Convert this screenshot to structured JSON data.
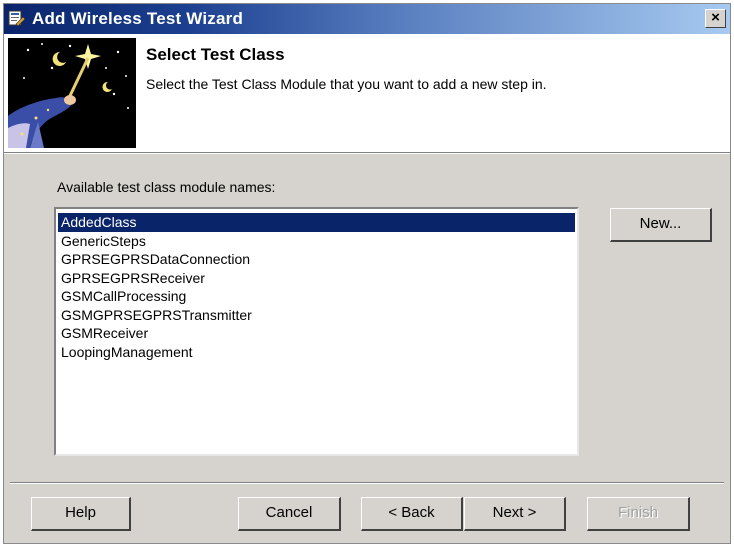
{
  "window": {
    "title": "Add Wireless Test Wizard",
    "close_label": "×"
  },
  "header": {
    "title": "Select Test Class",
    "description": "Select the Test Class Module that you want to add a new step in."
  },
  "list": {
    "label": "Available test class module names:",
    "selected_index": 0,
    "items": [
      "AddedClass",
      "GenericSteps",
      "GPRSEGPRSDataConnection",
      "GPRSEGPRSReceiver",
      "GSMCallProcessing",
      "GSMGPRSEGPRSTransmitter",
      "GSMReceiver",
      "LoopingManagement"
    ]
  },
  "buttons": {
    "new": "New...",
    "help": "Help",
    "cancel": "Cancel",
    "back": "< Back",
    "next": "Next >",
    "finish": "Finish"
  },
  "icons": {
    "app": "wizard-app-icon",
    "close": "close-icon",
    "header_picture": "wizard-illustration"
  },
  "colors": {
    "title_bar_start": "#0a246a",
    "title_bar_end": "#a6caf0",
    "dialog_face": "#d6d3ce",
    "selection": "#0a246a"
  }
}
